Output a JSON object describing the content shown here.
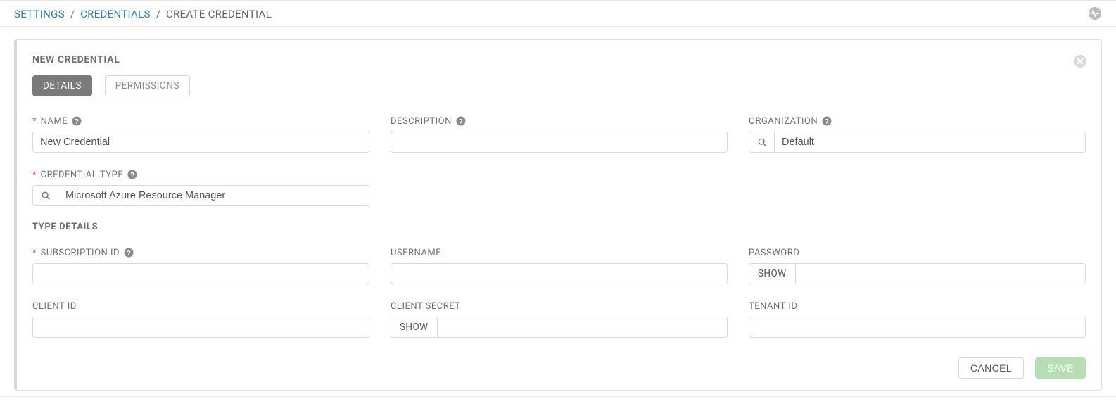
{
  "breadcrumb": {
    "items": [
      "SETTINGS",
      "CREDENTIALS"
    ],
    "current": "CREATE CREDENTIAL"
  },
  "panel": {
    "title": "NEW CREDENTIAL"
  },
  "tabs": {
    "details": "DETAILS",
    "permissions": "PERMISSIONS"
  },
  "fields": {
    "name": {
      "label": "NAME",
      "value": "New Credential"
    },
    "description": {
      "label": "DESCRIPTION",
      "value": ""
    },
    "organization": {
      "label": "ORGANIZATION",
      "value": "Default"
    },
    "credential_type": {
      "label": "CREDENTIAL TYPE",
      "value": "Microsoft Azure Resource Manager"
    },
    "type_details_header": "TYPE DETAILS",
    "subscription_id": {
      "label": "SUBSCRIPTION ID",
      "value": ""
    },
    "username": {
      "label": "USERNAME",
      "value": ""
    },
    "password": {
      "label": "PASSWORD",
      "value": "",
      "show": "SHOW"
    },
    "client_id": {
      "label": "CLIENT ID",
      "value": ""
    },
    "client_secret": {
      "label": "CLIENT SECRET",
      "value": "",
      "show": "SHOW"
    },
    "tenant_id": {
      "label": "TENANT ID",
      "value": ""
    }
  },
  "footer": {
    "cancel": "CANCEL",
    "save": "SAVE"
  }
}
